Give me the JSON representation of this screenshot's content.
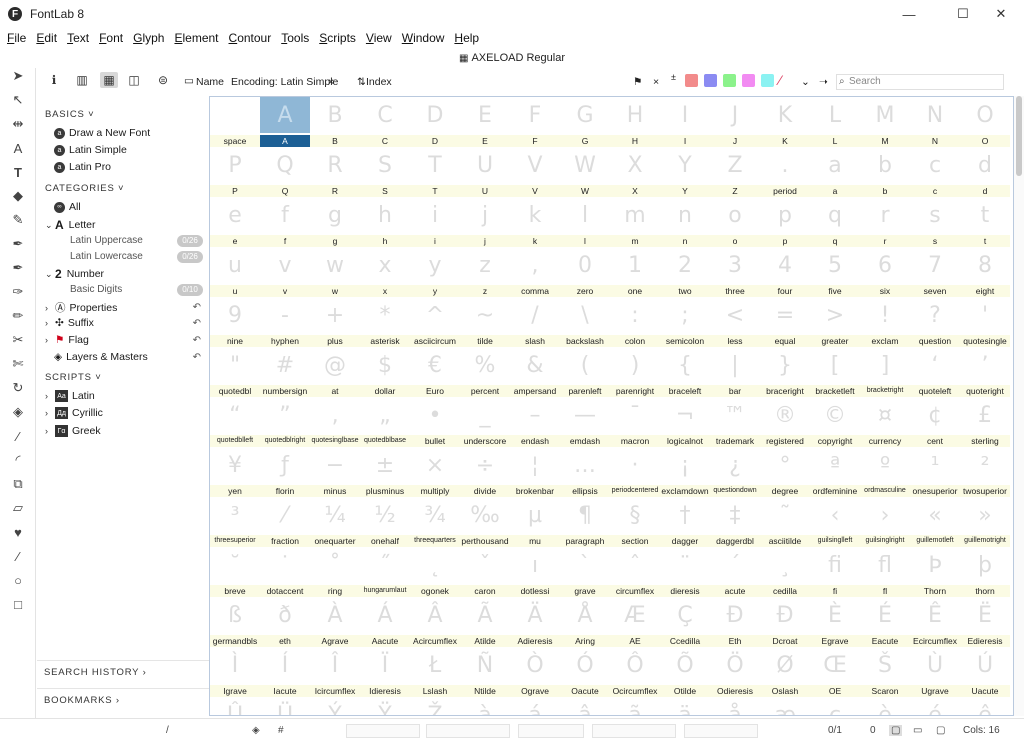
{
  "window": {
    "app_title": "FontLab 8",
    "logo_letter": "F",
    "minimize": "—",
    "maximize": "☐",
    "close": "✕"
  },
  "menu": [
    "File",
    "Edit",
    "Text",
    "Font",
    "Glyph",
    "Element",
    "Contour",
    "Tools",
    "Scripts",
    "View",
    "Window",
    "Help"
  ],
  "font_name": "AXELOAD Regular",
  "panel": {
    "basics_header": "BASICS",
    "basics": [
      "Draw a New Font",
      "Latin Simple",
      "Latin Pro"
    ],
    "categories_header": "CATEGORIES",
    "all": "All",
    "letter": "Letter",
    "latin_upper": "Latin Uppercase",
    "latin_upper_count": "0/26",
    "latin_lower": "Latin Lowercase",
    "latin_lower_count": "0/26",
    "number": "Number",
    "basic_digits": "Basic Digits",
    "basic_digits_count": "0/10",
    "properties": "Properties",
    "suffix": "Suffix",
    "flag": "Flag",
    "layers": "Layers & Masters",
    "scripts_header": "SCRIPTS",
    "scripts": [
      {
        "box": "Aa",
        "label": "Latin"
      },
      {
        "box": "Дд",
        "label": "Cyrillic"
      },
      {
        "box": "Γα",
        "label": "Greek"
      }
    ],
    "search_history": "SEARCH HISTORY",
    "bookmarks": "BOOKMARKS"
  },
  "toolbar": {
    "name_label": "Name",
    "encoding_label": "Encoding: Latin Simple",
    "index_label": "Index",
    "search_placeholder": "Search"
  },
  "colors": {
    "swatches": [
      "#f28b8b",
      "#8b8bf2",
      "#8bf28b",
      "#f28bf2",
      "#8bf2f2"
    ],
    "selection": "#1c5f95"
  },
  "glyphs": [
    {
      "g": "",
      "n": "space"
    },
    {
      "g": "A",
      "n": "A"
    },
    {
      "g": "B",
      "n": "B"
    },
    {
      "g": "C",
      "n": "C"
    },
    {
      "g": "D",
      "n": "D"
    },
    {
      "g": "E",
      "n": "E"
    },
    {
      "g": "F",
      "n": "F"
    },
    {
      "g": "G",
      "n": "G"
    },
    {
      "g": "H",
      "n": "H"
    },
    {
      "g": "I",
      "n": "I"
    },
    {
      "g": "J",
      "n": "J"
    },
    {
      "g": "K",
      "n": "K"
    },
    {
      "g": "L",
      "n": "L"
    },
    {
      "g": "M",
      "n": "M"
    },
    {
      "g": "N",
      "n": "N"
    },
    {
      "g": "O",
      "n": "O"
    },
    {
      "g": "P",
      "n": "P"
    },
    {
      "g": "Q",
      "n": "Q"
    },
    {
      "g": "R",
      "n": "R"
    },
    {
      "g": "S",
      "n": "S"
    },
    {
      "g": "T",
      "n": "T"
    },
    {
      "g": "U",
      "n": "U"
    },
    {
      "g": "V",
      "n": "V"
    },
    {
      "g": "W",
      "n": "W"
    },
    {
      "g": "X",
      "n": "X"
    },
    {
      "g": "Y",
      "n": "Y"
    },
    {
      "g": "Z",
      "n": "Z"
    },
    {
      "g": ".",
      "n": "period"
    },
    {
      "g": "a",
      "n": "a"
    },
    {
      "g": "b",
      "n": "b"
    },
    {
      "g": "c",
      "n": "c"
    },
    {
      "g": "d",
      "n": "d"
    },
    {
      "g": "e",
      "n": "e"
    },
    {
      "g": "f",
      "n": "f"
    },
    {
      "g": "g",
      "n": "g"
    },
    {
      "g": "h",
      "n": "h"
    },
    {
      "g": "i",
      "n": "i"
    },
    {
      "g": "j",
      "n": "j"
    },
    {
      "g": "k",
      "n": "k"
    },
    {
      "g": "l",
      "n": "l"
    },
    {
      "g": "m",
      "n": "m"
    },
    {
      "g": "n",
      "n": "n"
    },
    {
      "g": "o",
      "n": "o"
    },
    {
      "g": "p",
      "n": "p"
    },
    {
      "g": "q",
      "n": "q"
    },
    {
      "g": "r",
      "n": "r"
    },
    {
      "g": "s",
      "n": "s"
    },
    {
      "g": "t",
      "n": "t"
    },
    {
      "g": "u",
      "n": "u"
    },
    {
      "g": "v",
      "n": "v"
    },
    {
      "g": "w",
      "n": "w"
    },
    {
      "g": "x",
      "n": "x"
    },
    {
      "g": "y",
      "n": "y"
    },
    {
      "g": "z",
      "n": "z"
    },
    {
      "g": ",",
      "n": "comma"
    },
    {
      "g": "0",
      "n": "zero"
    },
    {
      "g": "1",
      "n": "one"
    },
    {
      "g": "2",
      "n": "two"
    },
    {
      "g": "3",
      "n": "three"
    },
    {
      "g": "4",
      "n": "four"
    },
    {
      "g": "5",
      "n": "five"
    },
    {
      "g": "6",
      "n": "six"
    },
    {
      "g": "7",
      "n": "seven"
    },
    {
      "g": "8",
      "n": "eight"
    },
    {
      "g": "9",
      "n": "nine"
    },
    {
      "g": "-",
      "n": "hyphen"
    },
    {
      "g": "+",
      "n": "plus"
    },
    {
      "g": "*",
      "n": "asterisk"
    },
    {
      "g": "^",
      "n": "asciicircum"
    },
    {
      "g": "~",
      "n": "tilde"
    },
    {
      "g": "/",
      "n": "slash"
    },
    {
      "g": "\\",
      "n": "backslash"
    },
    {
      "g": ":",
      "n": "colon"
    },
    {
      "g": ";",
      "n": "semicolon"
    },
    {
      "g": "<",
      "n": "less"
    },
    {
      "g": "=",
      "n": "equal"
    },
    {
      "g": ">",
      "n": "greater"
    },
    {
      "g": "!",
      "n": "exclam"
    },
    {
      "g": "?",
      "n": "question"
    },
    {
      "g": "'",
      "n": "quotesingle"
    },
    {
      "g": "\"",
      "n": "quotedbl"
    },
    {
      "g": "#",
      "n": "numbersign"
    },
    {
      "g": "@",
      "n": "at"
    },
    {
      "g": "$",
      "n": "dollar"
    },
    {
      "g": "€",
      "n": "Euro"
    },
    {
      "g": "%",
      "n": "percent"
    },
    {
      "g": "&",
      "n": "ampersand"
    },
    {
      "g": "(",
      "n": "parenleft"
    },
    {
      "g": ")",
      "n": "parenright"
    },
    {
      "g": "{",
      "n": "braceleft"
    },
    {
      "g": "|",
      "n": "bar"
    },
    {
      "g": "}",
      "n": "braceright"
    },
    {
      "g": "[",
      "n": "bracketleft"
    },
    {
      "g": "]",
      "n": "bracketright"
    },
    {
      "g": "‘",
      "n": "quoteleft"
    },
    {
      "g": "’",
      "n": "quoteright"
    },
    {
      "g": "“",
      "n": "quotedblleft"
    },
    {
      "g": "”",
      "n": "quotedblright"
    },
    {
      "g": "‚",
      "n": "quotesinglbase"
    },
    {
      "g": "„",
      "n": "quotedblbase"
    },
    {
      "g": "•",
      "n": "bullet"
    },
    {
      "g": "_",
      "n": "underscore"
    },
    {
      "g": "–",
      "n": "endash"
    },
    {
      "g": "—",
      "n": "emdash"
    },
    {
      "g": "¯",
      "n": "macron"
    },
    {
      "g": "¬",
      "n": "logicalnot"
    },
    {
      "g": "™",
      "n": "trademark"
    },
    {
      "g": "®",
      "n": "registered"
    },
    {
      "g": "©",
      "n": "copyright"
    },
    {
      "g": "¤",
      "n": "currency"
    },
    {
      "g": "¢",
      "n": "cent"
    },
    {
      "g": "£",
      "n": "sterling"
    },
    {
      "g": "¥",
      "n": "yen"
    },
    {
      "g": "ƒ",
      "n": "florin"
    },
    {
      "g": "−",
      "n": "minus"
    },
    {
      "g": "±",
      "n": "plusminus"
    },
    {
      "g": "×",
      "n": "multiply"
    },
    {
      "g": "÷",
      "n": "divide"
    },
    {
      "g": "¦",
      "n": "brokenbar"
    },
    {
      "g": "…",
      "n": "ellipsis"
    },
    {
      "g": "·",
      "n": "periodcentered"
    },
    {
      "g": "¡",
      "n": "exclamdown"
    },
    {
      "g": "¿",
      "n": "questiondown"
    },
    {
      "g": "°",
      "n": "degree"
    },
    {
      "g": "ª",
      "n": "ordfeminine"
    },
    {
      "g": "º",
      "n": "ordmasculine"
    },
    {
      "g": "¹",
      "n": "onesuperior"
    },
    {
      "g": "²",
      "n": "twosuperior"
    },
    {
      "g": "³",
      "n": "threesuperior"
    },
    {
      "g": "⁄",
      "n": "fraction"
    },
    {
      "g": "¼",
      "n": "onequarter"
    },
    {
      "g": "½",
      "n": "onehalf"
    },
    {
      "g": "¾",
      "n": "threequarters"
    },
    {
      "g": "‰",
      "n": "perthousand"
    },
    {
      "g": "µ",
      "n": "mu"
    },
    {
      "g": "¶",
      "n": "paragraph"
    },
    {
      "g": "§",
      "n": "section"
    },
    {
      "g": "†",
      "n": "dagger"
    },
    {
      "g": "‡",
      "n": "daggerdbl"
    },
    {
      "g": "˜",
      "n": "asciitilde"
    },
    {
      "g": "‹",
      "n": "guilsinglleft"
    },
    {
      "g": "›",
      "n": "guilsinglright"
    },
    {
      "g": "«",
      "n": "guillemotleft"
    },
    {
      "g": "»",
      "n": "guillemotright"
    },
    {
      "g": "˘",
      "n": "breve"
    },
    {
      "g": "˙",
      "n": "dotaccent"
    },
    {
      "g": "˚",
      "n": "ring"
    },
    {
      "g": "˝",
      "n": "hungarumlaut"
    },
    {
      "g": "˛",
      "n": "ogonek"
    },
    {
      "g": "ˇ",
      "n": "caron"
    },
    {
      "g": "ı",
      "n": "dotlessi"
    },
    {
      "g": "`",
      "n": "grave"
    },
    {
      "g": "ˆ",
      "n": "circumflex"
    },
    {
      "g": "¨",
      "n": "dieresis"
    },
    {
      "g": "´",
      "n": "acute"
    },
    {
      "g": "¸",
      "n": "cedilla"
    },
    {
      "g": "ﬁ",
      "n": "fi"
    },
    {
      "g": "ﬂ",
      "n": "fl"
    },
    {
      "g": "Þ",
      "n": "Thorn"
    },
    {
      "g": "þ",
      "n": "thorn"
    },
    {
      "g": "ß",
      "n": "germandbls"
    },
    {
      "g": "ð",
      "n": "eth"
    },
    {
      "g": "À",
      "n": "Agrave"
    },
    {
      "g": "Á",
      "n": "Aacute"
    },
    {
      "g": "Â",
      "n": "Acircumflex"
    },
    {
      "g": "Ã",
      "n": "Atilde"
    },
    {
      "g": "Ä",
      "n": "Adieresis"
    },
    {
      "g": "Å",
      "n": "Aring"
    },
    {
      "g": "Æ",
      "n": "AE"
    },
    {
      "g": "Ç",
      "n": "Ccedilla"
    },
    {
      "g": "Ð",
      "n": "Eth"
    },
    {
      "g": "Đ",
      "n": "Dcroat"
    },
    {
      "g": "È",
      "n": "Egrave"
    },
    {
      "g": "É",
      "n": "Eacute"
    },
    {
      "g": "Ê",
      "n": "Ecircumflex"
    },
    {
      "g": "Ë",
      "n": "Edieresis"
    },
    {
      "g": "Ì",
      "n": "Igrave"
    },
    {
      "g": "Í",
      "n": "Iacute"
    },
    {
      "g": "Î",
      "n": "Icircumflex"
    },
    {
      "g": "Ï",
      "n": "Idieresis"
    },
    {
      "g": "Ł",
      "n": "Lslash"
    },
    {
      "g": "Ñ",
      "n": "Ntilde"
    },
    {
      "g": "Ò",
      "n": "Ograve"
    },
    {
      "g": "Ó",
      "n": "Oacute"
    },
    {
      "g": "Ô",
      "n": "Ocircumflex"
    },
    {
      "g": "Õ",
      "n": "Otilde"
    },
    {
      "g": "Ö",
      "n": "Odieresis"
    },
    {
      "g": "Ø",
      "n": "Oslash"
    },
    {
      "g": "Œ",
      "n": "OE"
    },
    {
      "g": "Š",
      "n": "Scaron"
    },
    {
      "g": "Ù",
      "n": "Ugrave"
    },
    {
      "g": "Ú",
      "n": "Uacute"
    },
    {
      "g": "Û",
      "n": ""
    },
    {
      "g": "Ü",
      "n": ""
    },
    {
      "g": "Ý",
      "n": ""
    },
    {
      "g": "Ÿ",
      "n": ""
    },
    {
      "g": "Ž",
      "n": ""
    },
    {
      "g": "à",
      "n": ""
    },
    {
      "g": "á",
      "n": ""
    },
    {
      "g": "â",
      "n": ""
    },
    {
      "g": "ã",
      "n": ""
    },
    {
      "g": "ä",
      "n": ""
    },
    {
      "g": "å",
      "n": ""
    },
    {
      "g": "æ",
      "n": ""
    },
    {
      "g": "ç",
      "n": ""
    },
    {
      "g": "è",
      "n": ""
    },
    {
      "g": "é",
      "n": ""
    },
    {
      "g": "ê",
      "n": ""
    }
  ],
  "selected_index": 1,
  "status": {
    "slash": "/",
    "hash": "#",
    "selection_count": "0/1",
    "zero": "0",
    "cols_label": "Cols: 16"
  }
}
